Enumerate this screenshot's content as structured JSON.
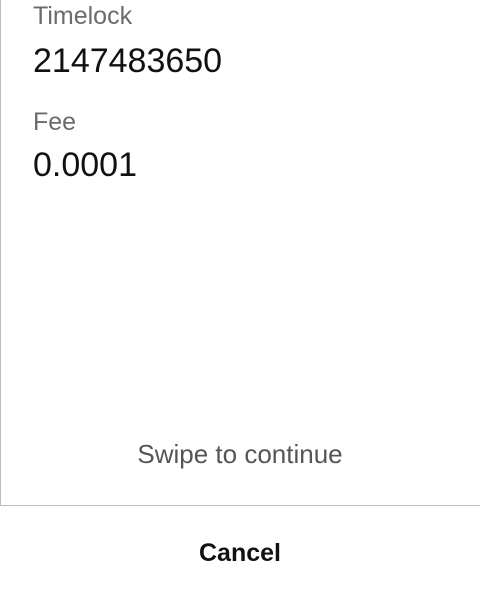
{
  "details": {
    "timelock_label": "Timelock",
    "timelock_value": "2147483650",
    "fee_label": "Fee",
    "fee_value": "0.0001"
  },
  "footer": {
    "swipe_hint": "Swipe to continue",
    "cancel_label": "Cancel"
  }
}
